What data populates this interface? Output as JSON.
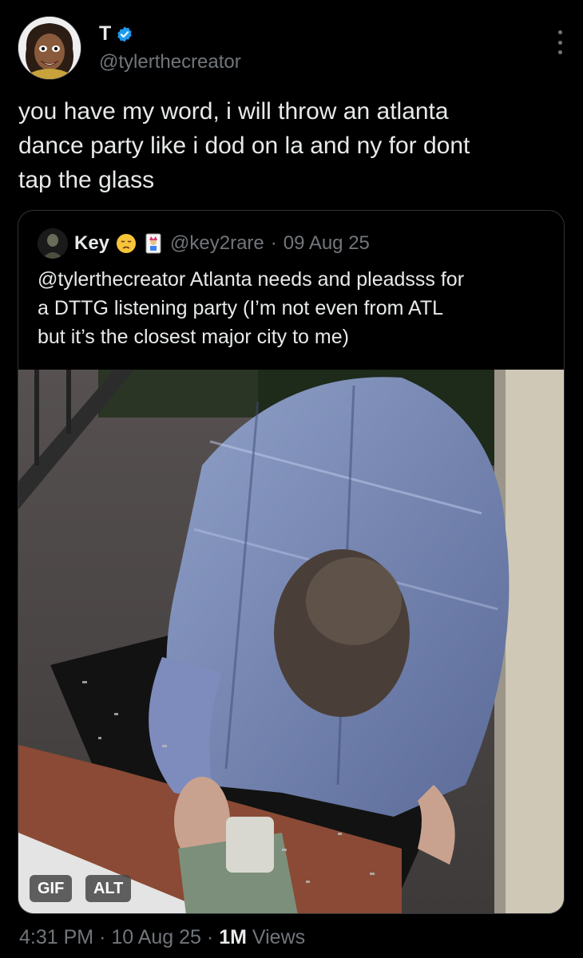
{
  "author": {
    "display_name": "T",
    "handle": "@tylerthecreator",
    "verified": true,
    "avatar_icon": "cartoon-avatar-icon"
  },
  "tweet": {
    "text": "you have my word, i will throw an atlanta\ndance party like i dod on la and ny for dont\ntap the glass"
  },
  "quote": {
    "display_name": "Key",
    "emoji_icons": [
      "pensive-face-emoji-icon",
      "joker-card-emoji-icon"
    ],
    "handle": "@key2rare",
    "separator": "·",
    "date": "09 Aug 25",
    "text": "@tylerthecreator Atlanta needs and pleadsss for\na DTTG listening party  (I’m not even from ATL\nbut it’s the closest major city to me)",
    "media": {
      "badges": [
        "GIF",
        "ALT"
      ]
    }
  },
  "meta": {
    "time": "4:31 PM",
    "sep1": "·",
    "date": "10 Aug 25",
    "sep2": "·",
    "views_count": "1M",
    "views_label": "Views"
  },
  "colors": {
    "background": "#000000",
    "text": "#e7e9ea",
    "muted": "#71767b",
    "verified": "#1d9bf0",
    "border": "#2f3336"
  }
}
